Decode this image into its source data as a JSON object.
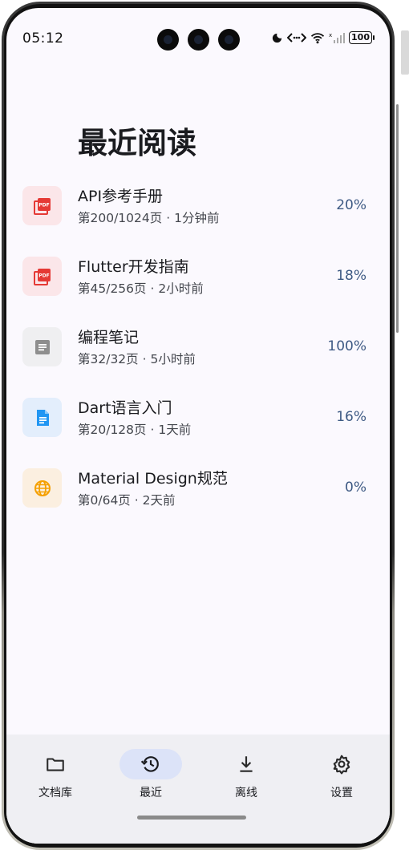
{
  "status_bar": {
    "time": "05:12",
    "battery": "100"
  },
  "page": {
    "title": "最近阅读"
  },
  "documents": [
    {
      "name": "API参考手册",
      "page": "第200/1024页",
      "time": "1分钟前",
      "progress": "20%",
      "icon": "pdf-icon",
      "icon_color": "#e53935",
      "icon_bg": "#fbe6e9"
    },
    {
      "name": "Flutter开发指南",
      "page": "第45/256页",
      "time": "2小时前",
      "progress": "18%",
      "icon": "pdf-icon",
      "icon_color": "#e53935",
      "icon_bg": "#fbe6e9"
    },
    {
      "name": "编程笔记",
      "page": "第32/32页",
      "time": "5小时前",
      "progress": "100%",
      "icon": "note-icon",
      "icon_color": "#8e8e8e",
      "icon_bg": "#efeff1"
    },
    {
      "name": "Dart语言入门",
      "page": "第20/128页",
      "time": "1天前",
      "progress": "16%",
      "icon": "document-icon",
      "icon_color": "#2196f3",
      "icon_bg": "#e3eefc"
    },
    {
      "name": "Material Design规范",
      "page": "第0/64页",
      "time": "2天前",
      "progress": "0%",
      "icon": "globe-icon",
      "icon_color": "#f5a000",
      "icon_bg": "#fbefe0"
    }
  ],
  "separator": "·",
  "bottom_nav": {
    "active": "recent",
    "items": [
      {
        "id": "library",
        "label": "文档库",
        "icon": "folder-icon"
      },
      {
        "id": "recent",
        "label": "最近",
        "icon": "history-icon"
      },
      {
        "id": "offline",
        "label": "离线",
        "icon": "download-icon"
      },
      {
        "id": "settings",
        "label": "设置",
        "icon": "gear-icon"
      }
    ]
  },
  "colors": {
    "background": "#fbf9fe",
    "progress_text": "#3e5a84",
    "nav_active_pill": "#dce3f8"
  }
}
